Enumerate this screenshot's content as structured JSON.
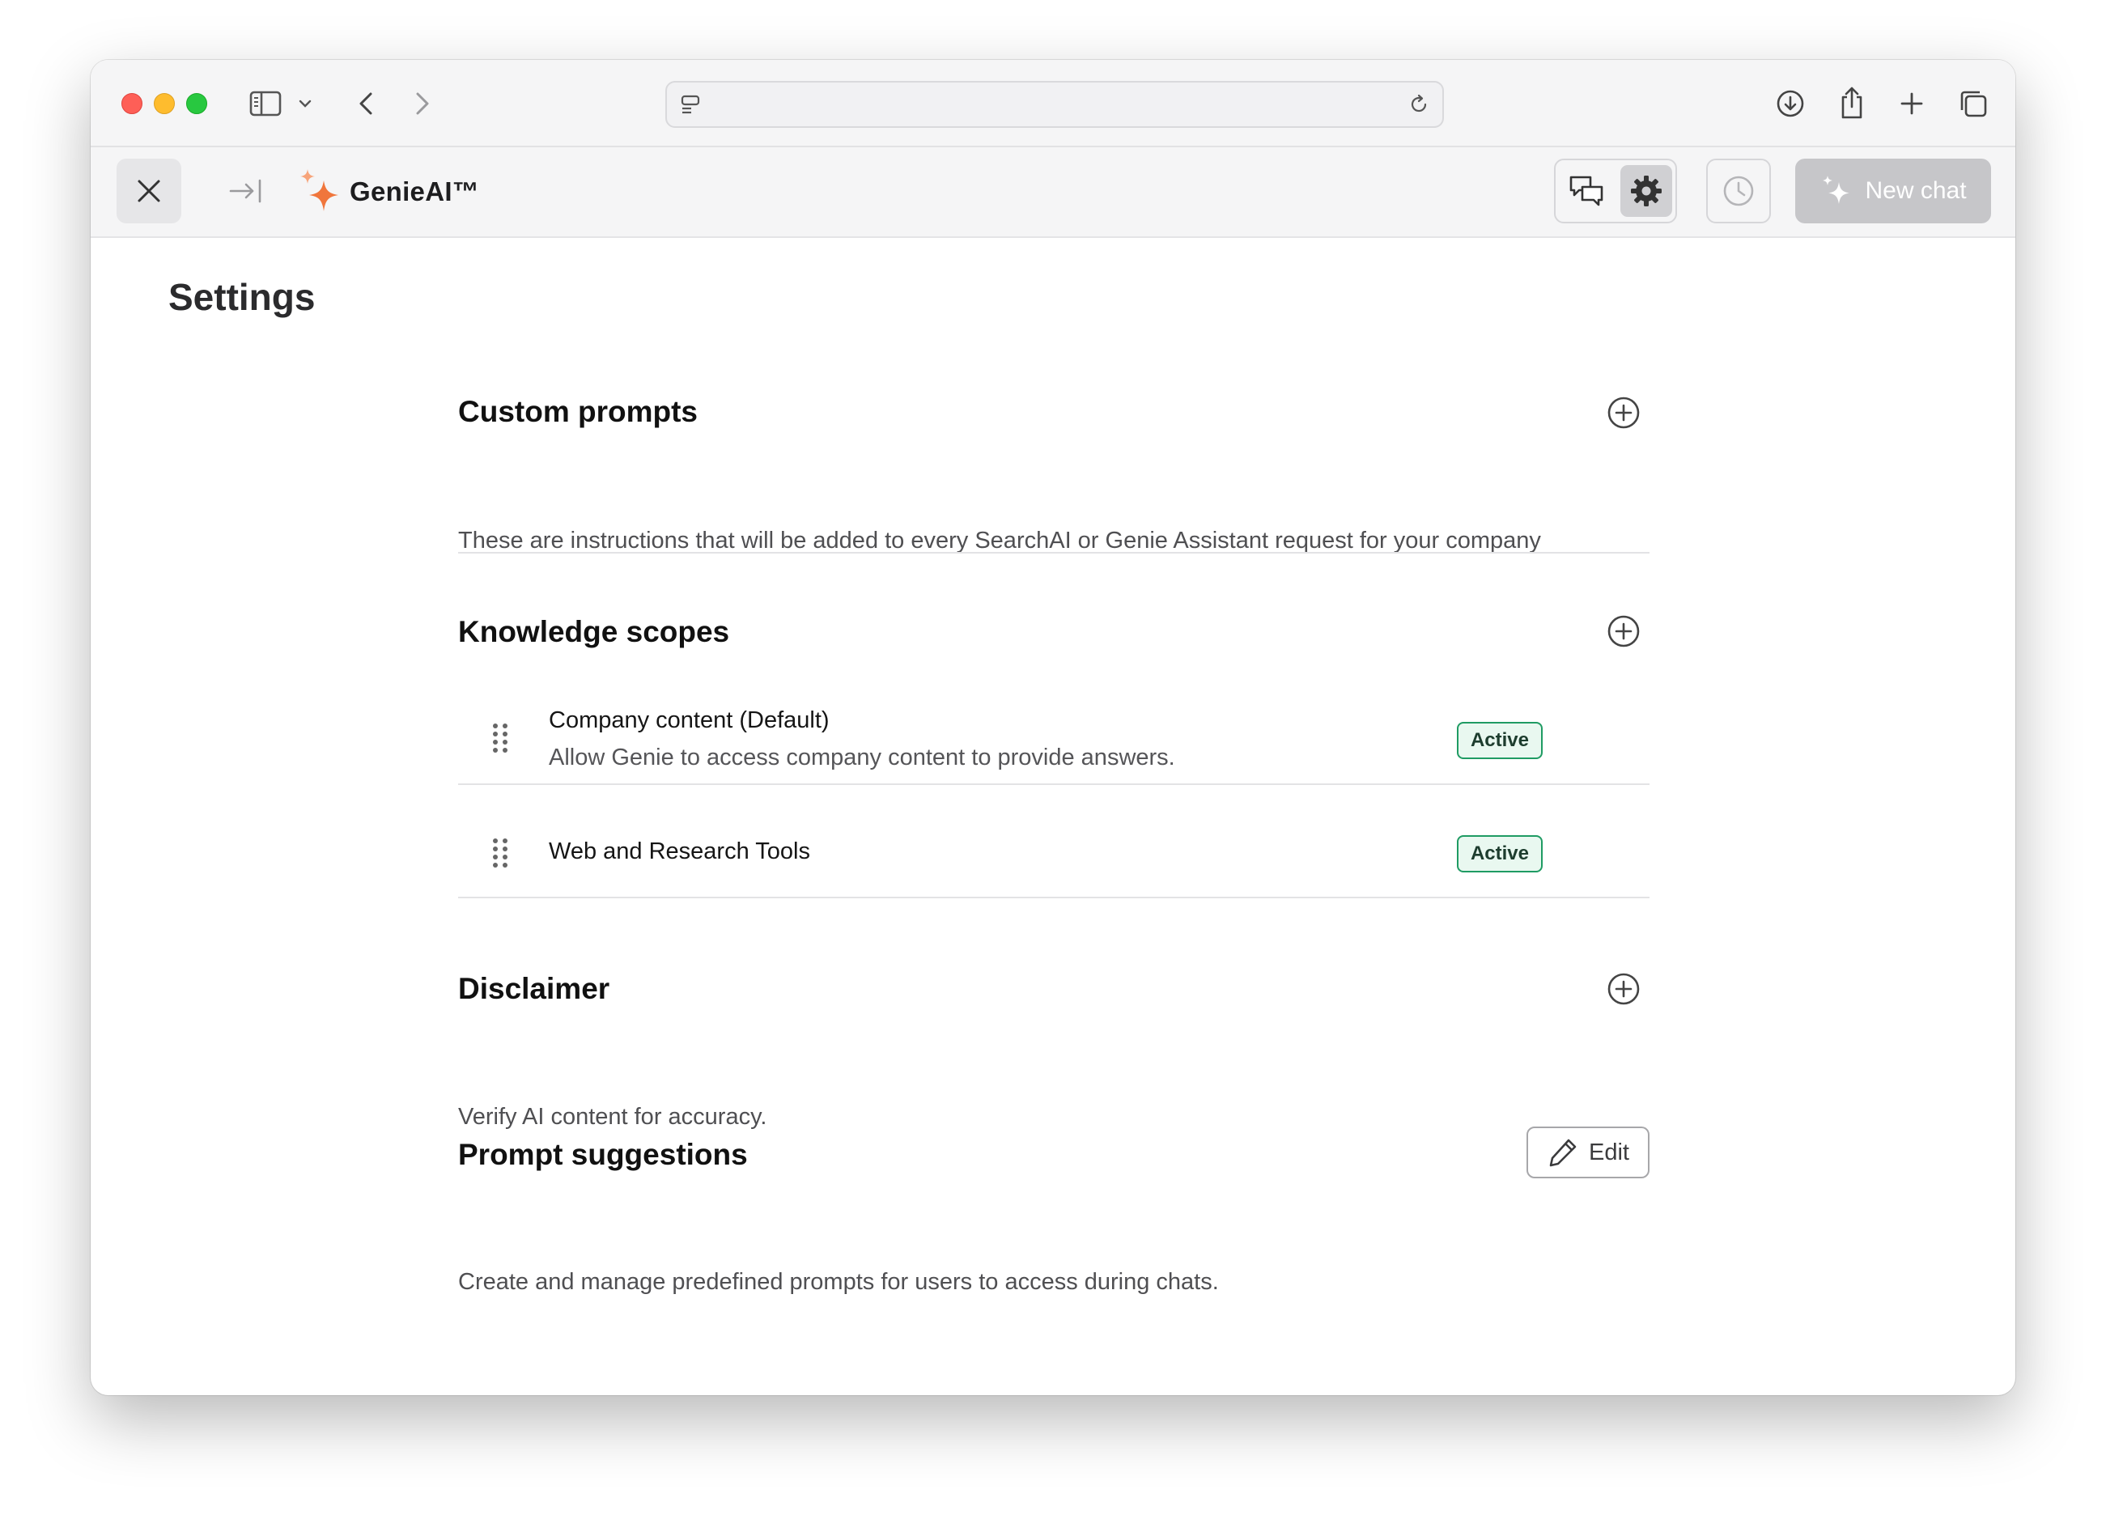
{
  "browser": {
    "url_value": "",
    "url_placeholder": ""
  },
  "app": {
    "brand_name": "GenieAI™",
    "brand_color": "#f0763c",
    "new_chat_label": "New chat"
  },
  "page": {
    "title": "Settings"
  },
  "sections": {
    "custom_prompts": {
      "title": "Custom prompts",
      "description": "These are instructions that will be added to every SearchAI or Genie Assistant request for your company"
    },
    "knowledge_scopes": {
      "title": "Knowledge scopes",
      "items": [
        {
          "name": "Company content (Default)",
          "description": "Allow Genie to access company content to provide answers.",
          "status": "Active"
        },
        {
          "name": "Web and Research Tools",
          "status": "Active"
        }
      ]
    },
    "disclaimer": {
      "title": "Disclaimer",
      "description": "Verify AI content for accuracy."
    },
    "prompt_suggestions": {
      "title": "Prompt suggestions",
      "description": "Create and manage predefined prompts for users to access during chats.",
      "edit_label": "Edit"
    }
  },
  "colors": {
    "status_active_border": "#1f9b63",
    "status_active_bg": "#e9f8f0"
  }
}
